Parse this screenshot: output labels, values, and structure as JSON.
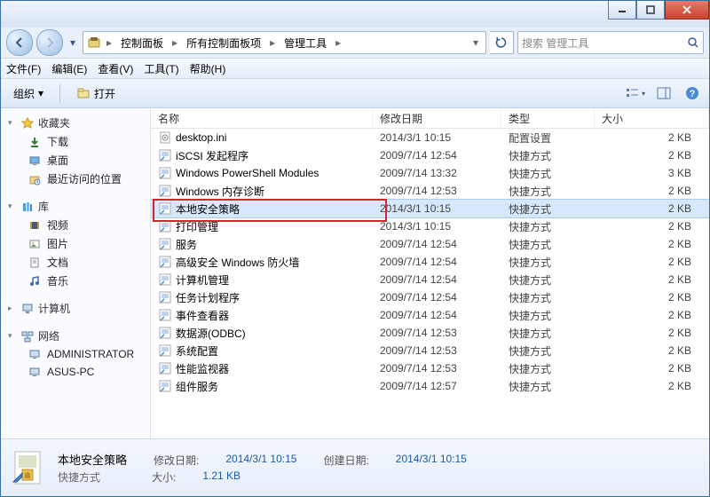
{
  "breadcrumb": {
    "items": [
      "控制面板",
      "所有控制面板项",
      "管理工具"
    ]
  },
  "search": {
    "placeholder": "搜索 管理工具"
  },
  "menubar": {
    "file": "文件(F)",
    "edit": "编辑(E)",
    "view": "查看(V)",
    "tools": "工具(T)",
    "help": "帮助(H)"
  },
  "toolbar": {
    "organize": "组织",
    "open": "打开"
  },
  "columns": {
    "name": "名称",
    "date": "修改日期",
    "type": "类型",
    "size": "大小"
  },
  "nav": {
    "favorites": {
      "label": "收藏夹",
      "items": [
        {
          "icon": "download",
          "label": "下载"
        },
        {
          "icon": "desktop",
          "label": "桌面"
        },
        {
          "icon": "recent",
          "label": "最近访问的位置"
        }
      ]
    },
    "libraries": {
      "label": "库",
      "items": [
        {
          "icon": "video",
          "label": "视频"
        },
        {
          "icon": "pictures",
          "label": "图片"
        },
        {
          "icon": "documents",
          "label": "文档"
        },
        {
          "icon": "music",
          "label": "音乐"
        }
      ]
    },
    "computer": {
      "label": "计算机"
    },
    "network": {
      "label": "网络",
      "items": [
        {
          "icon": "pc",
          "label": "ADMINISTRATOR"
        },
        {
          "icon": "pc",
          "label": "ASUS-PC"
        }
      ]
    }
  },
  "files": [
    {
      "name": "desktop.ini",
      "date": "2014/3/1 10:15",
      "type": "配置设置",
      "size": "2 KB",
      "selected": false
    },
    {
      "name": "iSCSI 发起程序",
      "date": "2009/7/14 12:54",
      "type": "快捷方式",
      "size": "2 KB",
      "selected": false
    },
    {
      "name": "Windows PowerShell Modules",
      "date": "2009/7/14 13:32",
      "type": "快捷方式",
      "size": "3 KB",
      "selected": false
    },
    {
      "name": "Windows 内存诊断",
      "date": "2009/7/14 12:53",
      "type": "快捷方式",
      "size": "2 KB",
      "selected": false
    },
    {
      "name": "本地安全策略",
      "date": "2014/3/1 10:15",
      "type": "快捷方式",
      "size": "2 KB",
      "selected": true
    },
    {
      "name": "打印管理",
      "date": "2014/3/1 10:15",
      "type": "快捷方式",
      "size": "2 KB",
      "selected": false
    },
    {
      "name": "服务",
      "date": "2009/7/14 12:54",
      "type": "快捷方式",
      "size": "2 KB",
      "selected": false
    },
    {
      "name": "高级安全 Windows 防火墙",
      "date": "2009/7/14 12:54",
      "type": "快捷方式",
      "size": "2 KB",
      "selected": false
    },
    {
      "name": "计算机管理",
      "date": "2009/7/14 12:54",
      "type": "快捷方式",
      "size": "2 KB",
      "selected": false
    },
    {
      "name": "任务计划程序",
      "date": "2009/7/14 12:54",
      "type": "快捷方式",
      "size": "2 KB",
      "selected": false
    },
    {
      "name": "事件查看器",
      "date": "2009/7/14 12:54",
      "type": "快捷方式",
      "size": "2 KB",
      "selected": false
    },
    {
      "name": "数据源(ODBC)",
      "date": "2009/7/14 12:53",
      "type": "快捷方式",
      "size": "2 KB",
      "selected": false
    },
    {
      "name": "系统配置",
      "date": "2009/7/14 12:53",
      "type": "快捷方式",
      "size": "2 KB",
      "selected": false
    },
    {
      "name": "性能监视器",
      "date": "2009/7/14 12:53",
      "type": "快捷方式",
      "size": "2 KB",
      "selected": false
    },
    {
      "name": "组件服务",
      "date": "2009/7/14 12:57",
      "type": "快捷方式",
      "size": "2 KB",
      "selected": false
    }
  ],
  "details": {
    "title": "本地安全策略",
    "sub": "快捷方式",
    "mod_label": "修改日期:",
    "mod_value": "2014/3/1 10:15",
    "create_label": "创建日期:",
    "create_value": "2014/3/1 10:15",
    "size_label": "大小:",
    "size_value": "1.21 KB"
  },
  "colors": {
    "accent": "#1a5aa8",
    "redbox": "#d4252a"
  }
}
